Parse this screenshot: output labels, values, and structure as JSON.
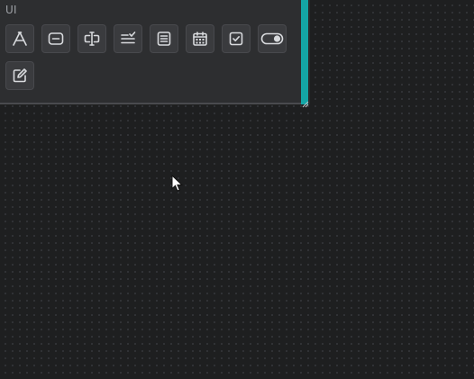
{
  "panel": {
    "section_label": "UI",
    "accent_color": "#14a6a6",
    "tools": [
      {
        "name": "text-tool",
        "icon": "text-a-icon"
      },
      {
        "name": "button-tool",
        "icon": "button-rect-icon"
      },
      {
        "name": "text-input-tool",
        "icon": "text-cursor-input-icon"
      },
      {
        "name": "dropdown-tool",
        "icon": "list-check-icon"
      },
      {
        "name": "textarea-tool",
        "icon": "text-lines-box-icon"
      },
      {
        "name": "date-picker-tool",
        "icon": "calendar-icon"
      },
      {
        "name": "checkbox-tool",
        "icon": "checkbox-checked-icon"
      },
      {
        "name": "toggle-tool",
        "icon": "toggle-switch-icon"
      },
      {
        "name": "edit-tool",
        "icon": "pencil-square-icon"
      }
    ]
  }
}
